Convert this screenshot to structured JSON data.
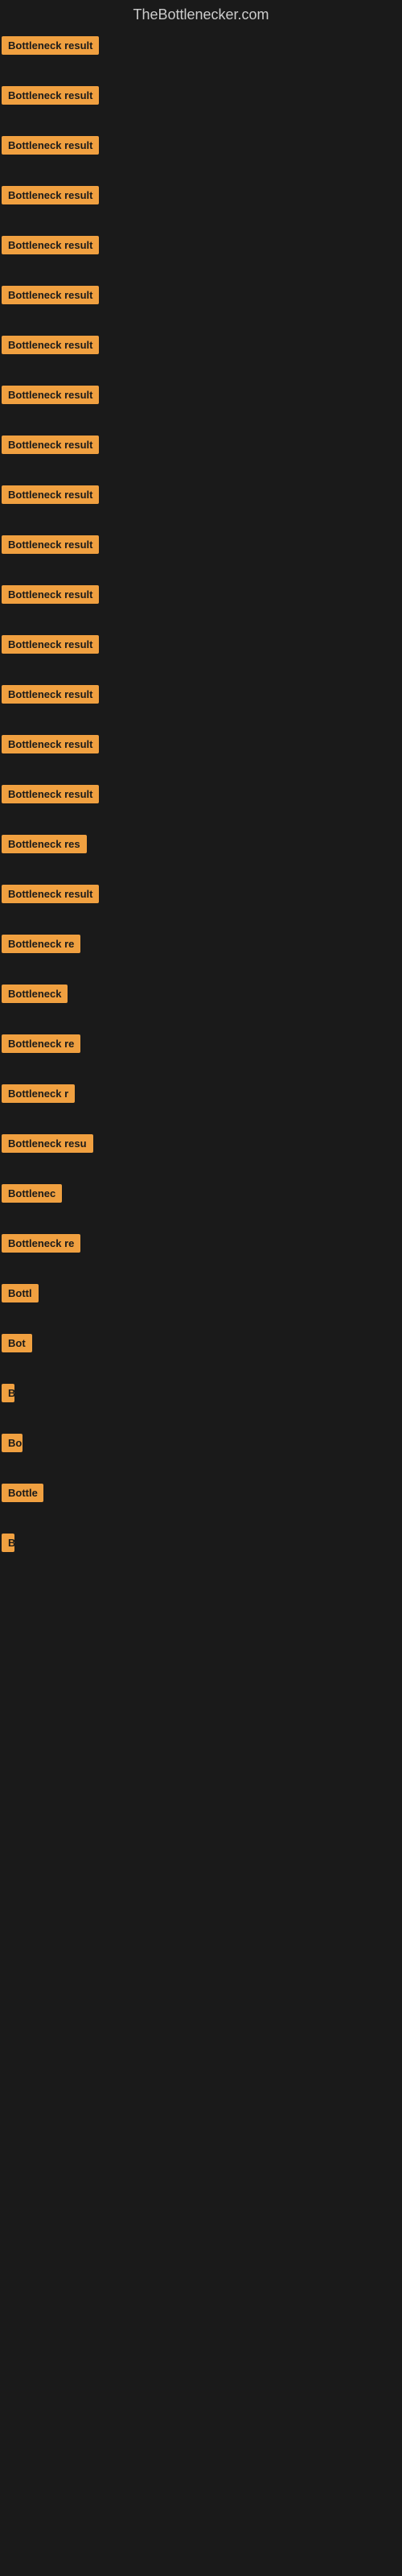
{
  "site": {
    "title": "TheBottlenecker.com"
  },
  "items": [
    {
      "label": "Bottleneck result",
      "width": 135
    },
    {
      "label": "Bottleneck result",
      "width": 135
    },
    {
      "label": "Bottleneck result",
      "width": 135
    },
    {
      "label": "Bottleneck result",
      "width": 135
    },
    {
      "label": "Bottleneck result",
      "width": 135
    },
    {
      "label": "Bottleneck result",
      "width": 135
    },
    {
      "label": "Bottleneck result",
      "width": 135
    },
    {
      "label": "Bottleneck result",
      "width": 135
    },
    {
      "label": "Bottleneck result",
      "width": 135
    },
    {
      "label": "Bottleneck result",
      "width": 135
    },
    {
      "label": "Bottleneck result",
      "width": 135
    },
    {
      "label": "Bottleneck result",
      "width": 135
    },
    {
      "label": "Bottleneck result",
      "width": 135
    },
    {
      "label": "Bottleneck result",
      "width": 135
    },
    {
      "label": "Bottleneck result",
      "width": 135
    },
    {
      "label": "Bottleneck result",
      "width": 135
    },
    {
      "label": "Bottleneck res",
      "width": 115
    },
    {
      "label": "Bottleneck result",
      "width": 135
    },
    {
      "label": "Bottleneck re",
      "width": 105
    },
    {
      "label": "Bottleneck",
      "width": 88
    },
    {
      "label": "Bottleneck re",
      "width": 105
    },
    {
      "label": "Bottleneck r",
      "width": 95
    },
    {
      "label": "Bottleneck resu",
      "width": 118
    },
    {
      "label": "Bottlenec",
      "width": 82
    },
    {
      "label": "Bottleneck re",
      "width": 105
    },
    {
      "label": "Bottl",
      "width": 48
    },
    {
      "label": "Bot",
      "width": 38
    },
    {
      "label": "B",
      "width": 16
    },
    {
      "label": "Bo",
      "width": 26
    },
    {
      "label": "Bottle",
      "width": 52
    },
    {
      "label": "B",
      "width": 14
    }
  ]
}
